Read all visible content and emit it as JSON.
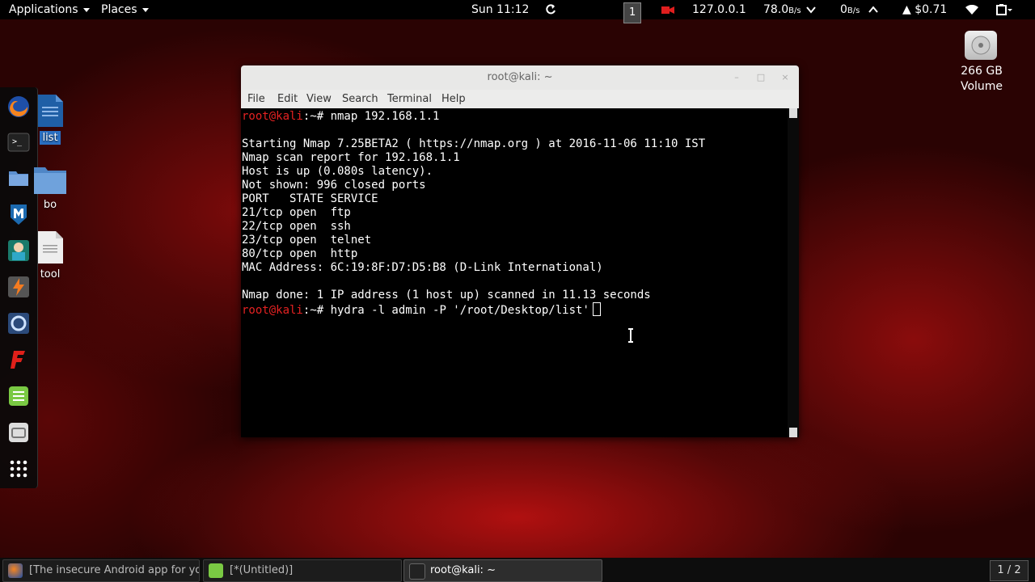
{
  "top_panel": {
    "applications": "Applications",
    "places": "Places",
    "clock": "Sun 11:12",
    "workspace": "1",
    "ip": "127.0.0.1",
    "down_rate": "78.0",
    "down_unit": "B/s",
    "up_rate": "0",
    "up_unit": "B/s",
    "stock": "▲ $0.71"
  },
  "desktop": {
    "icons": [
      {
        "label": "list"
      },
      {
        "label": "bo"
      },
      {
        "label": "tool"
      }
    ],
    "volume": {
      "line1": "266 GB",
      "line2": "Volume"
    }
  },
  "dock": {
    "icons": [
      "firefox-icon",
      "terminal-icon",
      "files-icon",
      "metasploit-icon",
      "armitage-icon",
      "burpsuite-icon",
      "maltego-icon",
      "faraday-icon",
      "leafpad-icon",
      "settings-icon",
      "show-apps-icon"
    ]
  },
  "terminal_window": {
    "title": "root@kali: ~",
    "menu": [
      "File",
      "Edit",
      "View",
      "Search",
      "Terminal",
      "Help"
    ],
    "prompt_user": "root@kali",
    "prompt_rest": ":~# ",
    "lines": [
      {
        "type": "prompt",
        "text": "nmap 192.168.1.1"
      },
      {
        "type": "out",
        "text": ""
      },
      {
        "type": "out",
        "text": "Starting Nmap 7.25BETA2 ( https://nmap.org ) at 2016-11-06 11:10 IST"
      },
      {
        "type": "out",
        "text": "Nmap scan report for 192.168.1.1"
      },
      {
        "type": "out",
        "text": "Host is up (0.080s latency)."
      },
      {
        "type": "out",
        "text": "Not shown: 996 closed ports"
      },
      {
        "type": "out",
        "text": "PORT   STATE SERVICE"
      },
      {
        "type": "out",
        "text": "21/tcp open  ftp"
      },
      {
        "type": "out",
        "text": "22/tcp open  ssh"
      },
      {
        "type": "out",
        "text": "23/tcp open  telnet"
      },
      {
        "type": "out",
        "text": "80/tcp open  http"
      },
      {
        "type": "out",
        "text": "MAC Address: 6C:19:8F:D7:D5:B8 (D-Link International)"
      },
      {
        "type": "out",
        "text": ""
      },
      {
        "type": "out",
        "text": "Nmap done: 1 IP address (1 host up) scanned in 11.13 seconds"
      },
      {
        "type": "prompt",
        "text": "hydra -l admin -P '/root/Desktop/list'",
        "cursor": true
      }
    ]
  },
  "taskbar": {
    "tasks": [
      {
        "label": "[The insecure Android app for you...",
        "icon": "firefox-icon",
        "active": false
      },
      {
        "label": "[*(Untitled)]",
        "icon": "leafpad-icon",
        "active": false
      },
      {
        "label": "root@kali: ~",
        "icon": "terminal-icon",
        "active": true
      }
    ],
    "pager": "1 / 2"
  }
}
